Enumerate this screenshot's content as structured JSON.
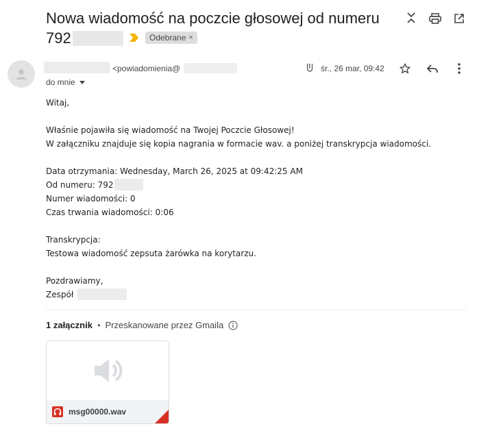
{
  "email": {
    "subject_line1": "Nowa wiadomość na poczcie głosowej od numeru",
    "subject_line2": "792",
    "label": "Odebrane",
    "label_remove": "×",
    "sender_email_prefix": "<powiadomienia@",
    "recipient": "do mnie",
    "date": "śr., 26 mar, 09:42"
  },
  "body": {
    "greeting": "Witaj,",
    "line1": "Właśnie pojawiła się wiadomość na Twojej Poczcie Głosowej!",
    "line2": "W załączniku znajduje się kopia nagrania w formacie wav. a poniżej transkrypcja wiadomości.",
    "date_received": "Data otrzymania: Wednesday, March 26, 2025 at 09:42:25 AM",
    "from_number": "Od numeru: 792",
    "message_number": "Numer wiadomości: 0",
    "duration": "Czas trwania wiadomości: 0:06",
    "transcription_label": "Transkrypcja:",
    "transcription": "Testowa wiadomość zepsuta żarówka na korytarzu.",
    "regards": "Pozdrawiamy,",
    "team": "Zespół"
  },
  "attachments": {
    "count_label": "1 załącznik",
    "separator": "•",
    "scanned": "Przeskanowane przez Gmaila",
    "files": [
      {
        "name": "msg00000.wav",
        "type_icon": "audio-file-icon"
      }
    ]
  },
  "icons": {
    "header": [
      "expand-collapse-icon",
      "print-icon",
      "open-new-window-icon"
    ],
    "row": [
      "paperclip-icon",
      "star-icon",
      "reply-icon",
      "more-vert-icon"
    ]
  },
  "colors": {
    "label_arrow": "#f4b400",
    "label_bg": "#dddddd",
    "attachment_fold": "#d93025",
    "audio_icon": "#d93025"
  }
}
